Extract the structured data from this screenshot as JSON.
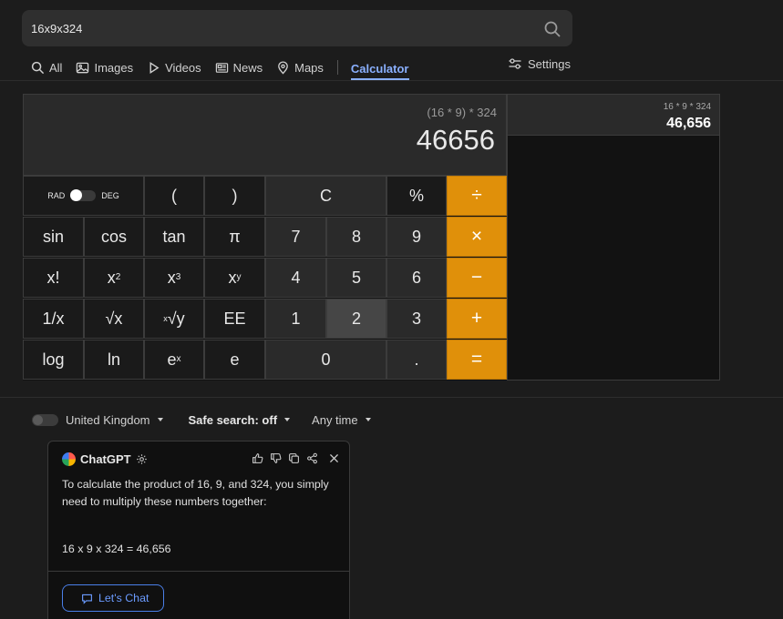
{
  "search": {
    "query": "16x9x324",
    "icon": "search-icon"
  },
  "tabs": [
    {
      "label": "All",
      "icon": "search-icon"
    },
    {
      "label": "Images",
      "icon": "image-icon"
    },
    {
      "label": "Videos",
      "icon": "play-icon"
    },
    {
      "label": "News",
      "icon": "newspaper-icon"
    },
    {
      "label": "Maps",
      "icon": "map-pin-icon"
    },
    {
      "label": "Calculator",
      "active": true
    }
  ],
  "settings": {
    "label": "Settings",
    "icon": "sliders-icon"
  },
  "calculator": {
    "expression": "(16 * 9) * 324",
    "result": "46656",
    "mode": {
      "rad": "RAD",
      "deg": "DEG"
    },
    "keys": {
      "open_paren": "(",
      "close_paren": ")",
      "clear": "C",
      "percent": "%",
      "divide": "÷",
      "sin": "sin",
      "cos": "cos",
      "tan": "tan",
      "pi": "π",
      "n7": "7",
      "n8": "8",
      "n9": "9",
      "multiply": "×",
      "factorial": "x!",
      "square_base": "x",
      "square_exp": "2",
      "cube_base": "x",
      "cube_exp": "3",
      "power_base": "x",
      "power_exp": "y",
      "n4": "4",
      "n5": "5",
      "n6": "6",
      "minus": "−",
      "reciprocal": "1/x",
      "sqrt": "√x",
      "yroot_pre": "x",
      "yroot": "√y",
      "ee": "EE",
      "n1": "1",
      "n2": "2",
      "n3": "3",
      "plus": "+",
      "log": "log",
      "ln": "ln",
      "exp_base": "e",
      "exp_exp": "x",
      "e": "e",
      "n0": "0",
      "dot": ".",
      "equals": "="
    }
  },
  "history": [
    {
      "expression": "16 * 9 * 324",
      "result": "46,656"
    }
  ],
  "filters": {
    "region": "United Kingdom",
    "safe_search": "Safe search: off",
    "time": "Any time"
  },
  "chat": {
    "title": "ChatGPT",
    "text1": "To calculate the product of 16, 9, and 324, you simply need to multiply these numbers together:",
    "text2": "16 x 9 x 324 = 46,656",
    "button": "Let's Chat"
  },
  "colors": {
    "accent": "#8ab0ff",
    "operator": "#e0900a",
    "link": "#6b9bff"
  }
}
